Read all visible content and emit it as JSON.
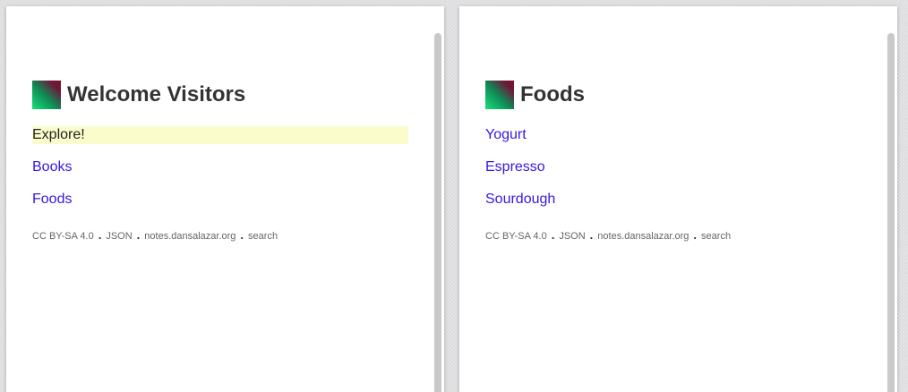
{
  "left_page": {
    "title": "Welcome Visitors",
    "highlight_text": "Explore!",
    "links": [
      "Books",
      "Foods"
    ]
  },
  "right_page": {
    "title": "Foods",
    "links": [
      "Yogurt",
      "Espresso",
      "Sourdough"
    ]
  },
  "footer": {
    "license": "CC BY-SA 4.0",
    "json": "JSON",
    "site": "notes.dansalazar.org",
    "search": "search",
    "separator": "."
  },
  "colors": {
    "link": "#3a16e0",
    "highlight": "#fafccc",
    "title": "#333333"
  }
}
